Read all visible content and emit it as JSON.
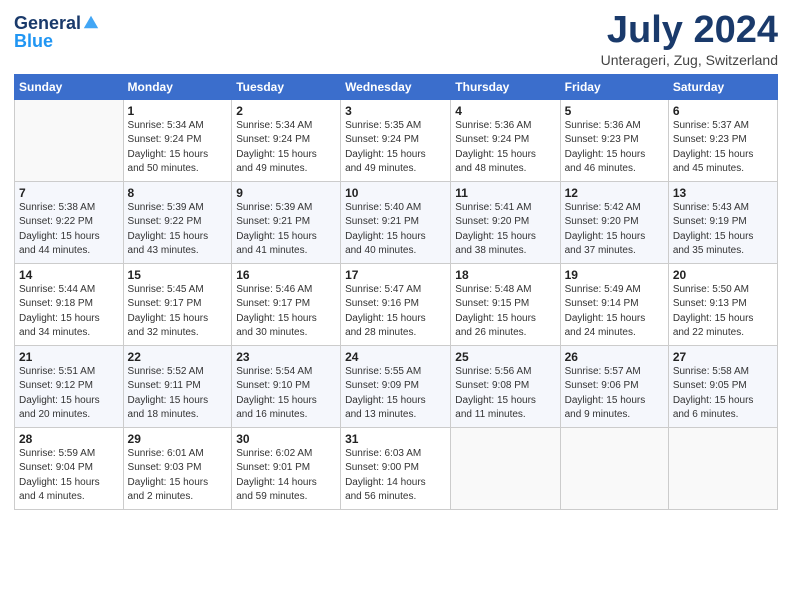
{
  "logo": {
    "line1": "General",
    "line2": "Blue"
  },
  "title": "July 2024",
  "location": "Unterageri, Zug, Switzerland",
  "weekdays": [
    "Sunday",
    "Monday",
    "Tuesday",
    "Wednesday",
    "Thursday",
    "Friday",
    "Saturday"
  ],
  "weeks": [
    [
      {
        "num": "",
        "info": ""
      },
      {
        "num": "1",
        "info": "Sunrise: 5:34 AM\nSunset: 9:24 PM\nDaylight: 15 hours\nand 50 minutes."
      },
      {
        "num": "2",
        "info": "Sunrise: 5:34 AM\nSunset: 9:24 PM\nDaylight: 15 hours\nand 49 minutes."
      },
      {
        "num": "3",
        "info": "Sunrise: 5:35 AM\nSunset: 9:24 PM\nDaylight: 15 hours\nand 49 minutes."
      },
      {
        "num": "4",
        "info": "Sunrise: 5:36 AM\nSunset: 9:24 PM\nDaylight: 15 hours\nand 48 minutes."
      },
      {
        "num": "5",
        "info": "Sunrise: 5:36 AM\nSunset: 9:23 PM\nDaylight: 15 hours\nand 46 minutes."
      },
      {
        "num": "6",
        "info": "Sunrise: 5:37 AM\nSunset: 9:23 PM\nDaylight: 15 hours\nand 45 minutes."
      }
    ],
    [
      {
        "num": "7",
        "info": "Sunrise: 5:38 AM\nSunset: 9:22 PM\nDaylight: 15 hours\nand 44 minutes."
      },
      {
        "num": "8",
        "info": "Sunrise: 5:39 AM\nSunset: 9:22 PM\nDaylight: 15 hours\nand 43 minutes."
      },
      {
        "num": "9",
        "info": "Sunrise: 5:39 AM\nSunset: 9:21 PM\nDaylight: 15 hours\nand 41 minutes."
      },
      {
        "num": "10",
        "info": "Sunrise: 5:40 AM\nSunset: 9:21 PM\nDaylight: 15 hours\nand 40 minutes."
      },
      {
        "num": "11",
        "info": "Sunrise: 5:41 AM\nSunset: 9:20 PM\nDaylight: 15 hours\nand 38 minutes."
      },
      {
        "num": "12",
        "info": "Sunrise: 5:42 AM\nSunset: 9:20 PM\nDaylight: 15 hours\nand 37 minutes."
      },
      {
        "num": "13",
        "info": "Sunrise: 5:43 AM\nSunset: 9:19 PM\nDaylight: 15 hours\nand 35 minutes."
      }
    ],
    [
      {
        "num": "14",
        "info": "Sunrise: 5:44 AM\nSunset: 9:18 PM\nDaylight: 15 hours\nand 34 minutes."
      },
      {
        "num": "15",
        "info": "Sunrise: 5:45 AM\nSunset: 9:17 PM\nDaylight: 15 hours\nand 32 minutes."
      },
      {
        "num": "16",
        "info": "Sunrise: 5:46 AM\nSunset: 9:17 PM\nDaylight: 15 hours\nand 30 minutes."
      },
      {
        "num": "17",
        "info": "Sunrise: 5:47 AM\nSunset: 9:16 PM\nDaylight: 15 hours\nand 28 minutes."
      },
      {
        "num": "18",
        "info": "Sunrise: 5:48 AM\nSunset: 9:15 PM\nDaylight: 15 hours\nand 26 minutes."
      },
      {
        "num": "19",
        "info": "Sunrise: 5:49 AM\nSunset: 9:14 PM\nDaylight: 15 hours\nand 24 minutes."
      },
      {
        "num": "20",
        "info": "Sunrise: 5:50 AM\nSunset: 9:13 PM\nDaylight: 15 hours\nand 22 minutes."
      }
    ],
    [
      {
        "num": "21",
        "info": "Sunrise: 5:51 AM\nSunset: 9:12 PM\nDaylight: 15 hours\nand 20 minutes."
      },
      {
        "num": "22",
        "info": "Sunrise: 5:52 AM\nSunset: 9:11 PM\nDaylight: 15 hours\nand 18 minutes."
      },
      {
        "num": "23",
        "info": "Sunrise: 5:54 AM\nSunset: 9:10 PM\nDaylight: 15 hours\nand 16 minutes."
      },
      {
        "num": "24",
        "info": "Sunrise: 5:55 AM\nSunset: 9:09 PM\nDaylight: 15 hours\nand 13 minutes."
      },
      {
        "num": "25",
        "info": "Sunrise: 5:56 AM\nSunset: 9:08 PM\nDaylight: 15 hours\nand 11 minutes."
      },
      {
        "num": "26",
        "info": "Sunrise: 5:57 AM\nSunset: 9:06 PM\nDaylight: 15 hours\nand 9 minutes."
      },
      {
        "num": "27",
        "info": "Sunrise: 5:58 AM\nSunset: 9:05 PM\nDaylight: 15 hours\nand 6 minutes."
      }
    ],
    [
      {
        "num": "28",
        "info": "Sunrise: 5:59 AM\nSunset: 9:04 PM\nDaylight: 15 hours\nand 4 minutes."
      },
      {
        "num": "29",
        "info": "Sunrise: 6:01 AM\nSunset: 9:03 PM\nDaylight: 15 hours\nand 2 minutes."
      },
      {
        "num": "30",
        "info": "Sunrise: 6:02 AM\nSunset: 9:01 PM\nDaylight: 14 hours\nand 59 minutes."
      },
      {
        "num": "31",
        "info": "Sunrise: 6:03 AM\nSunset: 9:00 PM\nDaylight: 14 hours\nand 56 minutes."
      },
      {
        "num": "",
        "info": ""
      },
      {
        "num": "",
        "info": ""
      },
      {
        "num": "",
        "info": ""
      }
    ]
  ]
}
